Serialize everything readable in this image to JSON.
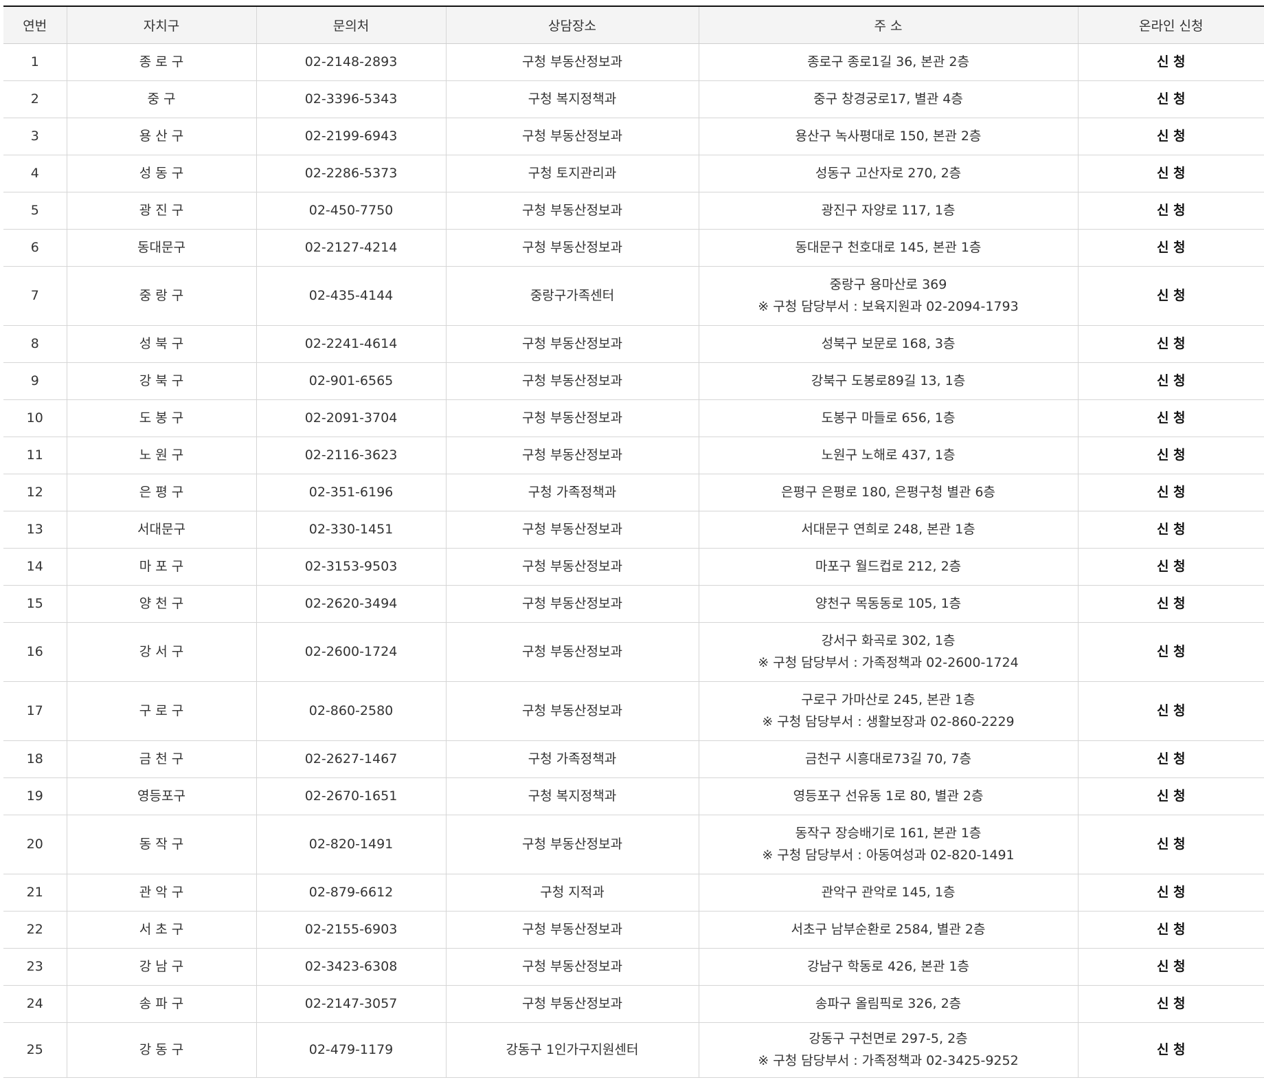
{
  "header": {
    "col_no": "연번",
    "col_district": "자치구",
    "col_phone": "문의처",
    "col_place": "상담장소",
    "col_address": "주 소",
    "col_online": "온라인 신청"
  },
  "apply_label": "신 청",
  "rows": [
    {
      "no": "1",
      "district": "종 로 구",
      "phone": "02-2148-2893",
      "place": "구청 부동산정보과",
      "address": "종로구 종로1길 36, 본관 2층",
      "note": ""
    },
    {
      "no": "2",
      "district": "중 구",
      "phone": "02-3396-5343",
      "place": "구청 복지정책과",
      "address": "중구 창경궁로17, 별관 4층",
      "note": ""
    },
    {
      "no": "3",
      "district": "용 산 구",
      "phone": "02-2199-6943",
      "place": "구청 부동산정보과",
      "address": "용산구 녹사평대로 150, 본관 2층",
      "note": ""
    },
    {
      "no": "4",
      "district": "성 동 구",
      "phone": "02-2286-5373",
      "place": "구청 토지관리과",
      "address": "성동구 고산자로 270, 2층",
      "note": ""
    },
    {
      "no": "5",
      "district": "광 진 구",
      "phone": "02-450-7750",
      "place": "구청 부동산정보과",
      "address": "광진구 자양로 117, 1층",
      "note": ""
    },
    {
      "no": "6",
      "district": "동대문구",
      "phone": "02-2127-4214",
      "place": "구청 부동산정보과",
      "address": "동대문구 천호대로 145, 본관 1층",
      "note": ""
    },
    {
      "no": "7",
      "district": "중 랑 구",
      "phone": "02-435-4144",
      "place": "중랑구가족센터",
      "address": "중랑구 용마산로 369",
      "note": "※ 구청 담당부서 : 보육지원과 02-2094-1793"
    },
    {
      "no": "8",
      "district": "성 북 구",
      "phone": "02-2241-4614",
      "place": "구청 부동산정보과",
      "address": "성북구 보문로 168, 3층",
      "note": ""
    },
    {
      "no": "9",
      "district": "강 북 구",
      "phone": "02-901-6565",
      "place": "구청 부동산정보과",
      "address": "강북구 도봉로89길 13, 1층",
      "note": ""
    },
    {
      "no": "10",
      "district": "도 봉 구",
      "phone": "02-2091-3704",
      "place": "구청 부동산정보과",
      "address": "도봉구 마들로 656, 1층",
      "note": ""
    },
    {
      "no": "11",
      "district": "노 원 구",
      "phone": "02-2116-3623",
      "place": "구청 부동산정보과",
      "address": "노원구 노해로 437, 1층",
      "note": ""
    },
    {
      "no": "12",
      "district": "은 평 구",
      "phone": "02-351-6196",
      "place": "구청 가족정책과",
      "address": "은평구 은평로 180, 은평구청 별관 6층",
      "note": ""
    },
    {
      "no": "13",
      "district": "서대문구",
      "phone": "02-330-1451",
      "place": "구청 부동산정보과",
      "address": "서대문구 연희로 248, 본관 1층",
      "note": ""
    },
    {
      "no": "14",
      "district": "마 포 구",
      "phone": "02-3153-9503",
      "place": "구청 부동산정보과",
      "address": "마포구 월드컵로 212, 2층",
      "note": ""
    },
    {
      "no": "15",
      "district": "양 천 구",
      "phone": "02-2620-3494",
      "place": "구청 부동산정보과",
      "address": "양천구 목동동로 105, 1층",
      "note": ""
    },
    {
      "no": "16",
      "district": "강 서 구",
      "phone": "02-2600-1724",
      "place": "구청 부동산정보과",
      "address": "강서구 화곡로 302, 1층",
      "note": "※ 구청 담당부서 : 가족정책과 02-2600-1724"
    },
    {
      "no": "17",
      "district": "구 로 구",
      "phone": "02-860-2580",
      "place": "구청 부동산정보과",
      "address": "구로구 가마산로 245, 본관 1층",
      "note": "※ 구청 담당부서 : 생활보장과 02-860-2229"
    },
    {
      "no": "18",
      "district": "금 천 구",
      "phone": "02-2627-1467",
      "place": "구청 가족정책과",
      "address": "금천구 시흥대로73길 70, 7층",
      "note": ""
    },
    {
      "no": "19",
      "district": "영등포구",
      "phone": "02-2670-1651",
      "place": "구청 복지정책과",
      "address": "영등포구 선유동 1로 80, 별관 2층",
      "note": ""
    },
    {
      "no": "20",
      "district": "동 작 구",
      "phone": "02-820-1491",
      "place": "구청 부동산정보과",
      "address": "동작구 장승배기로 161, 본관 1층",
      "note": "※ 구청 담당부서 : 아동여성과 02-820-1491"
    },
    {
      "no": "21",
      "district": "관 악 구",
      "phone": "02-879-6612",
      "place": "구청 지적과",
      "address": "관악구 관악로 145, 1층",
      "note": ""
    },
    {
      "no": "22",
      "district": "서 초 구",
      "phone": "02-2155-6903",
      "place": "구청 부동산정보과",
      "address": "서초구 남부순환로 2584, 별관 2층",
      "note": ""
    },
    {
      "no": "23",
      "district": "강 남 구",
      "phone": "02-3423-6308",
      "place": "구청 부동산정보과",
      "address": "강남구 학동로 426, 본관 1층",
      "note": ""
    },
    {
      "no": "24",
      "district": "송 파 구",
      "phone": "02-2147-3057",
      "place": "구청 부동산정보과",
      "address": "송파구 올림픽로 326, 2층",
      "note": ""
    },
    {
      "no": "25",
      "district": "강 동 구",
      "phone": "02-479-1179",
      "place": "강동구 1인가구지원센터",
      "address": "강동구 구천면로 297-5, 2층",
      "note": "※ 구청 담당부서 : 가족정책과 02-3425-9252"
    }
  ]
}
